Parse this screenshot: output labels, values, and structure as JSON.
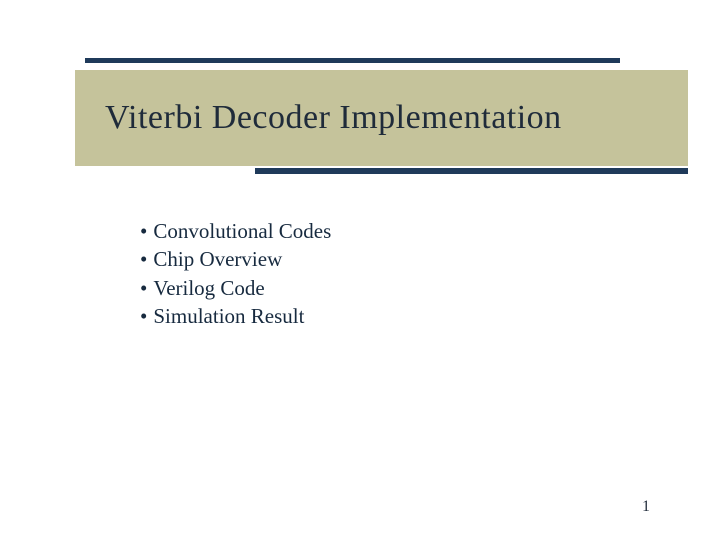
{
  "title": "Viterbi Decoder Implementation",
  "bullets": {
    "items": [
      "Convolutional Codes",
      "Chip Overview",
      "Verilog Code",
      "Simulation Result"
    ]
  },
  "page_number": "1"
}
